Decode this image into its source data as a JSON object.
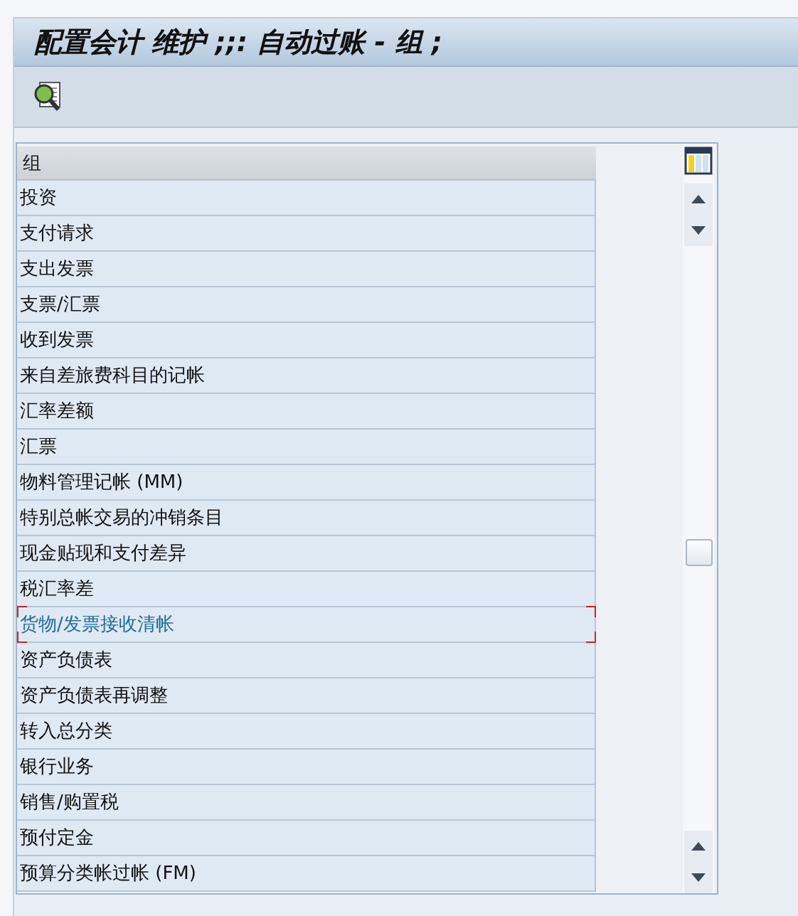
{
  "window": {
    "title": "配置会计 维护 ;;: 自动过账 - 组 ;"
  },
  "table": {
    "columns": [
      "组"
    ],
    "rows": [
      {
        "label": "投资",
        "selected": false
      },
      {
        "label": "支付请求",
        "selected": false
      },
      {
        "label": "支出发票",
        "selected": false
      },
      {
        "label": "支票/汇票",
        "selected": false
      },
      {
        "label": "收到发票",
        "selected": false
      },
      {
        "label": "来自差旅费科目的记帐",
        "selected": false
      },
      {
        "label": "汇率差额",
        "selected": false
      },
      {
        "label": "汇票",
        "selected": false
      },
      {
        "label": "物料管理记帐 (MM)",
        "selected": false
      },
      {
        "label": "特别总帐交易的冲销条目",
        "selected": false
      },
      {
        "label": "现金贴现和支付差异",
        "selected": false
      },
      {
        "label": "税汇率差",
        "selected": false
      },
      {
        "label": "货物/发票接收清帐",
        "selected": true
      },
      {
        "label": "资产负债表",
        "selected": false
      },
      {
        "label": "资产负债表再调整",
        "selected": false
      },
      {
        "label": "转入总分类",
        "selected": false
      },
      {
        "label": "银行业务",
        "selected": false
      },
      {
        "label": "销售/购置税",
        "selected": false
      },
      {
        "label": "预付定金",
        "selected": false
      },
      {
        "label": "预算分类帐过帐 (FM)",
        "selected": false
      }
    ]
  }
}
